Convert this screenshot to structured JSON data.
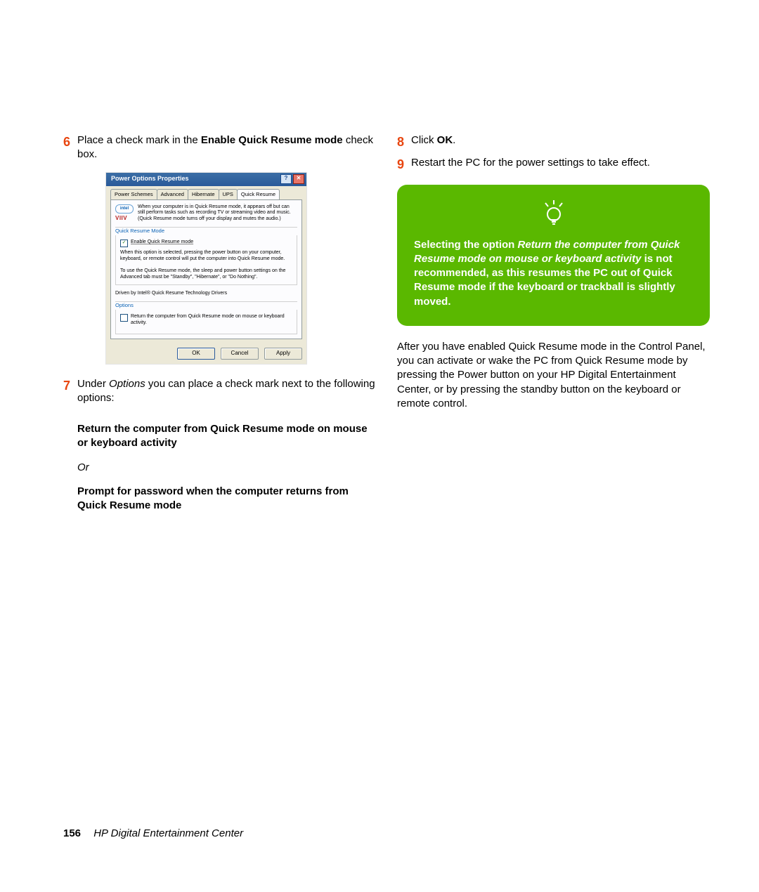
{
  "step6": {
    "num": "6",
    "pre": " Place a check mark in the ",
    "bold": "Enable Quick Resume mode",
    "post": " check box."
  },
  "dialog": {
    "title": "Power Options Properties",
    "tabs": [
      "Power Schemes",
      "Advanced",
      "Hibernate",
      "UPS",
      "Quick Resume"
    ],
    "intro": "When your computer is in Quick Resume mode, it appears off but can still perform tasks such as recording TV or streaming video and music. (Quick Resume mode turns off your display and mutes the audio.)",
    "group1_title": "Quick Resume Mode",
    "cb1_label": "Enable Quick Resume mode",
    "g1_p1": "When this option is selected, pressing the power button on your computer, keyboard, or remote control will put the computer into Quick Resume mode.",
    "g1_p2": "To use the Quick Resume mode, the sleep and power button settings on the Advanced tab must be \"Standby\", \"Hibernate\", or \"Do Nothing\".",
    "driver": "Driven by Intel® Quick Resume Technology Drivers",
    "group2_title": "Options",
    "cb2_label": "Return the computer from Quick Resume mode on mouse or keyboard activity.",
    "btn_ok": "OK",
    "btn_cancel": "Cancel",
    "btn_apply": "Apply"
  },
  "step7": {
    "num": "7",
    "pre": " Under ",
    "opt": "Options",
    "post": " you can place a check mark next to the following options:",
    "boldA": "Return the computer from Quick Resume mode on mouse or keyboard activity",
    "or": "Or",
    "boldB": "Prompt for password when the computer returns from Quick Resume mode"
  },
  "step8": {
    "num": "8",
    "pre": " Click ",
    "bold": "OK",
    "post": "."
  },
  "step9": {
    "num": "9",
    "txt": " Restart the PC for the power settings to take effect."
  },
  "callout": {
    "l1a": "Selecting the option ",
    "l1b": "Return the computer from Quick Resume mode on mouse or keyboard activity",
    "l2": " is not recommended, as this resumes the PC out of Quick Resume mode if the keyboard or trackball is slightly moved."
  },
  "after": "After you have enabled Quick Resume mode in the Control Panel, you can activate or wake the PC from Quick Resume mode by pressing the Power button on your HP Digital Entertainment Center, or by pressing the standby button on the keyboard or remote control.",
  "footer": {
    "page": "156",
    "title": "HP Digital Entertainment Center"
  }
}
